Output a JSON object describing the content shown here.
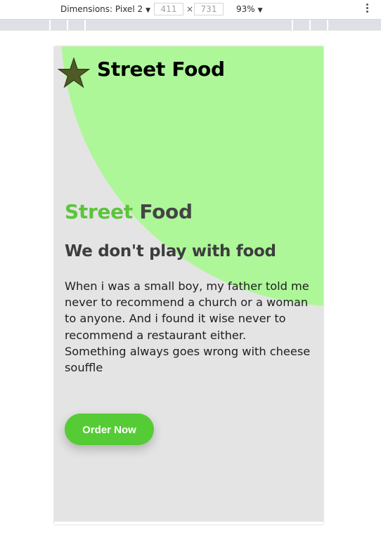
{
  "devtools": {
    "dimensions_label": "Dimensions: Pixel 2",
    "width_value": "411",
    "height_value": "731",
    "times": "×",
    "zoom": "93%"
  },
  "site": {
    "brand": "Street Food",
    "logo_icon": "star-icon",
    "hero": {
      "title_accent": "Street",
      "title_rest": "Food",
      "tagline": "We don't play with food",
      "description": "When i was a small boy, my father told me never to recommend a church or a woman to anyone. And i found it wise never to recommend a restaurant either. Something always goes wrong with cheese souffle",
      "cta_label": "Order Now"
    }
  },
  "colors": {
    "accent": "#5cc43c",
    "blob": "#adf799",
    "button": "#55cc36",
    "background": "#e4e4e4"
  }
}
